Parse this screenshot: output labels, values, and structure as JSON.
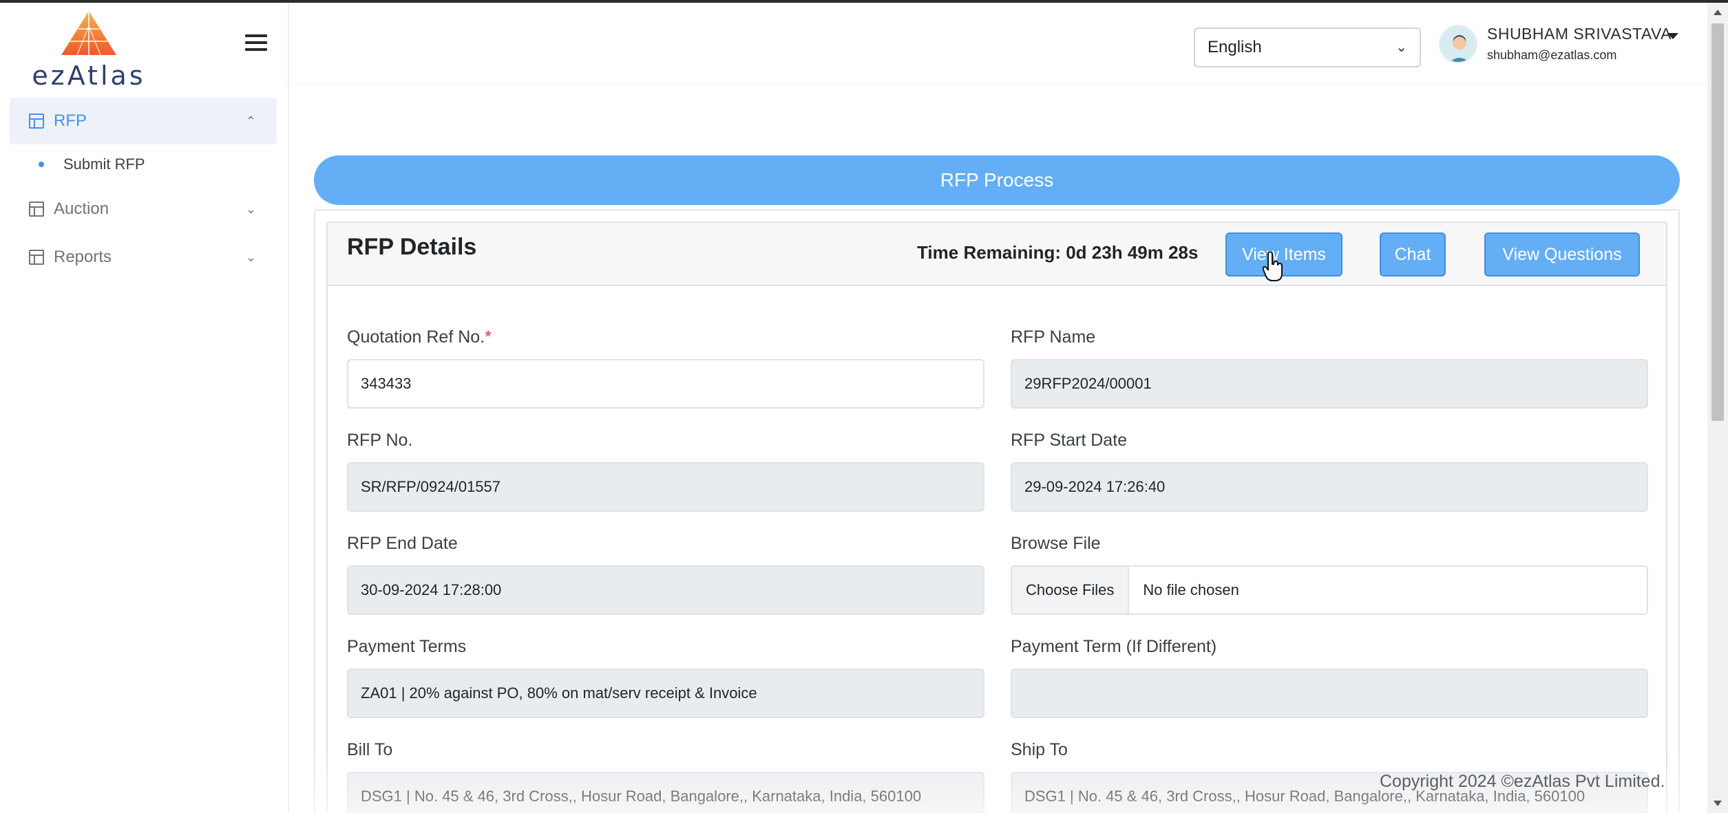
{
  "app": {
    "brand": "ezAtlas"
  },
  "sidebar": {
    "items": [
      {
        "label": "RFP",
        "active": true,
        "chevron": "chevron-up-icon"
      },
      {
        "label": "Auction",
        "active": false,
        "chevron": "chevron-down-icon"
      },
      {
        "label": "Reports",
        "active": false,
        "chevron": "chevron-down-icon"
      }
    ],
    "subitems": [
      {
        "label": "Submit RFP"
      }
    ]
  },
  "header": {
    "language": "English",
    "user_name": "SHUBHAM SRIVASTAVA",
    "user_email": "shubham@ezatlas.com"
  },
  "main": {
    "banner": "RFP Process",
    "card_title": "RFP Details",
    "time_remaining": "Time Remaining: 0d 23h 49m 28s",
    "buttons": {
      "view_items": "View Items",
      "chat": "Chat",
      "view_questions": "View Questions"
    },
    "fields": {
      "quotation_ref": {
        "label": "Quotation Ref No.",
        "required": "*",
        "value": "343433"
      },
      "rfp_name": {
        "label": "RFP Name",
        "value": "29RFP2024/00001"
      },
      "rfp_no": {
        "label": "RFP No.",
        "value": "SR/RFP/0924/01557"
      },
      "rfp_start_date": {
        "label": "RFP Start Date",
        "value": "29-09-2024 17:26:40"
      },
      "rfp_end_date": {
        "label": "RFP End Date",
        "value": "30-09-2024 17:28:00"
      },
      "browse_file": {
        "label": "Browse File",
        "button": "Choose Files",
        "status": "No file chosen"
      },
      "payment_terms": {
        "label": "Payment Terms",
        "value": "ZA01 | 20% against PO, 80% on mat/serv receipt & Invoice"
      },
      "payment_term_diff": {
        "label": "Payment Term (If Different)",
        "value": ""
      },
      "bill_to": {
        "label": "Bill To",
        "value": "DSG1 | No. 45 & 46, 3rd Cross,, Hosur Road, Bangalore,, Karnataka, India, 560100"
      },
      "ship_to": {
        "label": "Ship To",
        "value": "DSG1 | No. 45 & 46, 3rd Cross,, Hosur Road, Bangalore,, Karnataka, India, 560100"
      }
    }
  },
  "footer": {
    "copyright": "Copyright 2024 ©ezAtlas Pvt Limited."
  },
  "colors": {
    "accent": "#64aef5",
    "accent_border": "#3e8fe0",
    "sidebar_active": "#4a90e2",
    "readonly_bg": "#e9ecef",
    "required": "#dc3545"
  }
}
